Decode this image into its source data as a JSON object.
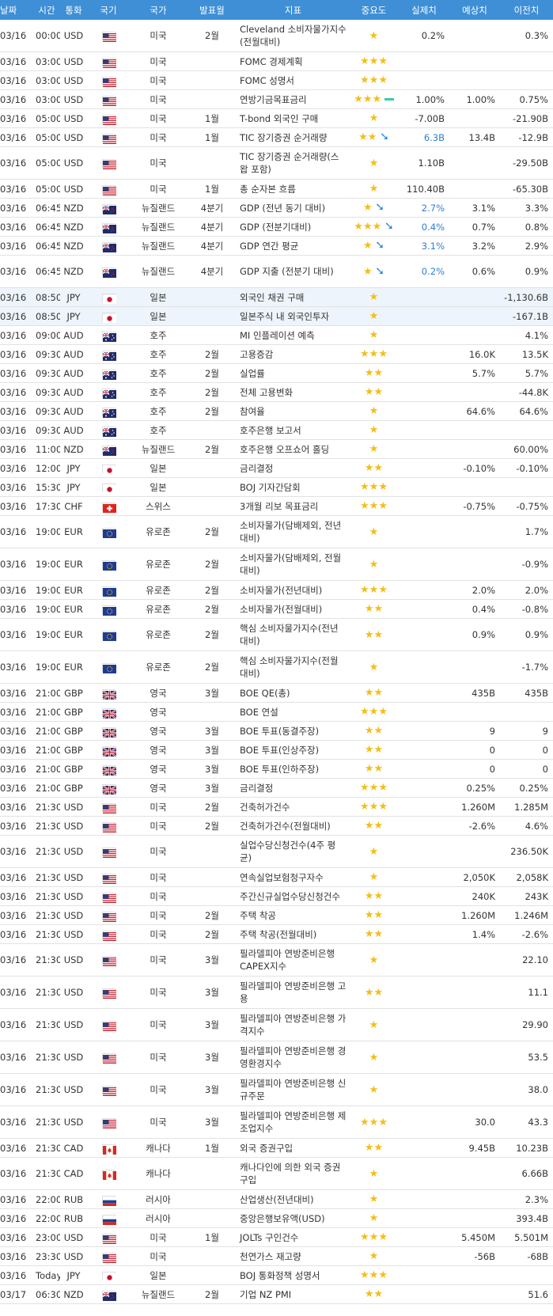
{
  "header": [
    "날짜",
    "시간",
    "통화",
    "국기",
    "국가",
    "발표월",
    "지표",
    "중요도",
    "실제치",
    "예상치",
    "이전치"
  ],
  "rows": [
    {
      "date": "03/16",
      "time": "00:00",
      "cur": "USD",
      "flag": "us",
      "country": "미국",
      "month": "2월",
      "ind": "Cleveland 소비자물가지수(전월대비)",
      "stars": 1,
      "trend": "",
      "actual": "0.2%",
      "forecast": "",
      "prev": "0.3%"
    },
    {
      "date": "03/16",
      "time": "03:00",
      "cur": "USD",
      "flag": "us",
      "country": "미국",
      "month": "",
      "ind": "FOMC 경제계획",
      "stars": 3,
      "trend": "",
      "actual": "",
      "forecast": "",
      "prev": ""
    },
    {
      "date": "03/16",
      "time": "03:00",
      "cur": "USD",
      "flag": "us",
      "country": "미국",
      "month": "",
      "ind": "FOMC 성명서",
      "stars": 3,
      "trend": "",
      "actual": "",
      "forecast": "",
      "prev": ""
    },
    {
      "date": "03/16",
      "time": "03:00",
      "cur": "USD",
      "flag": "us",
      "country": "미국",
      "month": "",
      "ind": "연방기금목표금리",
      "stars": 3,
      "trend": "flat",
      "actual": "1.00%",
      "forecast": "1.00%",
      "prev": "0.75%"
    },
    {
      "date": "03/16",
      "time": "05:00",
      "cur": "USD",
      "flag": "us",
      "country": "미국",
      "month": "1월",
      "ind": "T-bond 외국인 구매",
      "stars": 1,
      "trend": "",
      "actual": "-7.00B",
      "forecast": "",
      "prev": "-21.90B"
    },
    {
      "date": "03/16",
      "time": "05:00",
      "cur": "USD",
      "flag": "us",
      "country": "미국",
      "month": "1월",
      "ind": "TIC 장기증권 순거래량",
      "stars": 2,
      "trend": "down",
      "actual": "6.3B",
      "forecast": "13.4B",
      "prev": "-12.9B"
    },
    {
      "date": "03/16",
      "time": "05:00",
      "cur": "USD",
      "flag": "us",
      "country": "미국",
      "month": "",
      "ind": "TIC 장기증권 순거래량(스왑 포함)",
      "stars": 1,
      "trend": "",
      "actual": "1.10B",
      "forecast": "",
      "prev": "-29.50B"
    },
    {
      "date": "03/16",
      "time": "05:00",
      "cur": "USD",
      "flag": "us",
      "country": "미국",
      "month": "1월",
      "ind": "총 순자본 흐름",
      "stars": 1,
      "trend": "",
      "actual": "110.40B",
      "forecast": "",
      "prev": "-65.30B"
    },
    {
      "date": "03/16",
      "time": "06:45",
      "cur": "NZD",
      "flag": "nz",
      "country": "뉴질랜드",
      "month": "4분기",
      "ind": "GDP (전년 동기 대비)",
      "stars": 1,
      "trend": "down",
      "actual": "2.7%",
      "forecast": "3.1%",
      "prev": "3.3%"
    },
    {
      "date": "03/16",
      "time": "06:45",
      "cur": "NZD",
      "flag": "nz",
      "country": "뉴질랜드",
      "month": "4분기",
      "ind": "GDP (전분기대비)",
      "stars": 3,
      "trend": "down",
      "actual": "0.4%",
      "forecast": "0.7%",
      "prev": "0.8%"
    },
    {
      "date": "03/16",
      "time": "06:45",
      "cur": "NZD",
      "flag": "nz",
      "country": "뉴질랜드",
      "month": "4분기",
      "ind": "GDP 연간 평균",
      "stars": 1,
      "trend": "down",
      "actual": "3.1%",
      "forecast": "3.2%",
      "prev": "2.9%"
    },
    {
      "date": "03/16",
      "time": "06:45",
      "cur": "NZD",
      "flag": "nz",
      "country": "뉴질랜드",
      "month": "4분기",
      "ind": "GDP 지출 (전분기 대비)",
      "stars": 1,
      "trend": "down",
      "actual": "0.2%",
      "forecast": "0.6%",
      "prev": "0.9%"
    },
    {
      "date": "03/16",
      "time": "08:50",
      "cur": "JPY",
      "flag": "jp",
      "country": "일본",
      "month": "",
      "ind": "외국인 채권 구매",
      "stars": 1,
      "trend": "",
      "actual": "",
      "forecast": "",
      "prev": "-1,130.6B",
      "hl": true
    },
    {
      "date": "03/16",
      "time": "08:50",
      "cur": "JPY",
      "flag": "jp",
      "country": "일본",
      "month": "",
      "ind": "일본주식 내 외국인투자",
      "stars": 1,
      "trend": "",
      "actual": "",
      "forecast": "",
      "prev": "-167.1B",
      "hl": true
    },
    {
      "date": "03/16",
      "time": "09:00",
      "cur": "AUD",
      "flag": "au",
      "country": "호주",
      "month": "",
      "ind": "MI 인플레이션 예측",
      "stars": 1,
      "trend": "",
      "actual": "",
      "forecast": "",
      "prev": "4.1%"
    },
    {
      "date": "03/16",
      "time": "09:30",
      "cur": "AUD",
      "flag": "au",
      "country": "호주",
      "month": "2월",
      "ind": "고용증감",
      "stars": 3,
      "trend": "",
      "actual": "",
      "forecast": "16.0K",
      "prev": "13.5K"
    },
    {
      "date": "03/16",
      "time": "09:30",
      "cur": "AUD",
      "flag": "au",
      "country": "호주",
      "month": "2월",
      "ind": "실업률",
      "stars": 2,
      "trend": "",
      "actual": "",
      "forecast": "5.7%",
      "prev": "5.7%"
    },
    {
      "date": "03/16",
      "time": "09:30",
      "cur": "AUD",
      "flag": "au",
      "country": "호주",
      "month": "2월",
      "ind": "전체 고용변화",
      "stars": 2,
      "trend": "",
      "actual": "",
      "forecast": "",
      "prev": "-44.8K"
    },
    {
      "date": "03/16",
      "time": "09:30",
      "cur": "AUD",
      "flag": "au",
      "country": "호주",
      "month": "2월",
      "ind": "참여율",
      "stars": 1,
      "trend": "",
      "actual": "",
      "forecast": "64.6%",
      "prev": "64.6%"
    },
    {
      "date": "03/16",
      "time": "09:30",
      "cur": "AUD",
      "flag": "au",
      "country": "호주",
      "month": "",
      "ind": "호주은행 보고서",
      "stars": 1,
      "trend": "",
      "actual": "",
      "forecast": "",
      "prev": ""
    },
    {
      "date": "03/16",
      "time": "11:00",
      "cur": "NZD",
      "flag": "nz",
      "country": "뉴질랜드",
      "month": "2월",
      "ind": "호주은행 오프쇼어 홀딩",
      "stars": 1,
      "trend": "",
      "actual": "",
      "forecast": "",
      "prev": "60.00%"
    },
    {
      "date": "03/16",
      "time": "12:00",
      "cur": "JPY",
      "flag": "jp",
      "country": "일본",
      "month": "",
      "ind": "금리결정",
      "stars": 2,
      "trend": "",
      "actual": "",
      "forecast": "-0.10%",
      "prev": "-0.10%"
    },
    {
      "date": "03/16",
      "time": "15:30",
      "cur": "JPY",
      "flag": "jp",
      "country": "일본",
      "month": "",
      "ind": "BOJ 기자간담회",
      "stars": 3,
      "trend": "",
      "actual": "",
      "forecast": "",
      "prev": ""
    },
    {
      "date": "03/16",
      "time": "17:30",
      "cur": "CHF",
      "flag": "ch",
      "country": "스위스",
      "month": "",
      "ind": "3개월 리보 목표금리",
      "stars": 3,
      "trend": "",
      "actual": "",
      "forecast": "-0.75%",
      "prev": "-0.75%"
    },
    {
      "date": "03/16",
      "time": "19:00",
      "cur": "EUR",
      "flag": "eu",
      "country": "유로존",
      "month": "2월",
      "ind": "소비자물가(담배제외, 전년대비)",
      "stars": 1,
      "trend": "",
      "actual": "",
      "forecast": "",
      "prev": "1.7%"
    },
    {
      "date": "03/16",
      "time": "19:00",
      "cur": "EUR",
      "flag": "eu",
      "country": "유로존",
      "month": "2월",
      "ind": "소비자물가(담배제외, 전월대비)",
      "stars": 1,
      "trend": "",
      "actual": "",
      "forecast": "",
      "prev": "-0.9%"
    },
    {
      "date": "03/16",
      "time": "19:00",
      "cur": "EUR",
      "flag": "eu",
      "country": "유로존",
      "month": "2월",
      "ind": "소비자물가(전년대비)",
      "stars": 3,
      "trend": "",
      "actual": "",
      "forecast": "2.0%",
      "prev": "2.0%"
    },
    {
      "date": "03/16",
      "time": "19:00",
      "cur": "EUR",
      "flag": "eu",
      "country": "유로존",
      "month": "2월",
      "ind": "소비자물가(전월대비)",
      "stars": 2,
      "trend": "",
      "actual": "",
      "forecast": "0.4%",
      "prev": "-0.8%"
    },
    {
      "date": "03/16",
      "time": "19:00",
      "cur": "EUR",
      "flag": "eu",
      "country": "유로존",
      "month": "2월",
      "ind": "핵심 소비자물가지수(전년대비)",
      "stars": 2,
      "trend": "",
      "actual": "",
      "forecast": "0.9%",
      "prev": "0.9%"
    },
    {
      "date": "03/16",
      "time": "19:00",
      "cur": "EUR",
      "flag": "eu",
      "country": "유로존",
      "month": "2월",
      "ind": "핵심 소비자물가지수(전월대비)",
      "stars": 1,
      "trend": "",
      "actual": "",
      "forecast": "",
      "prev": "-1.7%"
    },
    {
      "date": "03/16",
      "time": "21:00",
      "cur": "GBP",
      "flag": "gb",
      "country": "영국",
      "month": "3월",
      "ind": "BOE QE(총)",
      "stars": 2,
      "trend": "",
      "actual": "",
      "forecast": "435B",
      "prev": "435B"
    },
    {
      "date": "03/16",
      "time": "21:00",
      "cur": "GBP",
      "flag": "gb",
      "country": "영국",
      "month": "",
      "ind": "BOE 연설",
      "stars": 3,
      "trend": "",
      "actual": "",
      "forecast": "",
      "prev": ""
    },
    {
      "date": "03/16",
      "time": "21:00",
      "cur": "GBP",
      "flag": "gb",
      "country": "영국",
      "month": "3월",
      "ind": "BOE 투표(동결주장)",
      "stars": 2,
      "trend": "",
      "actual": "",
      "forecast": "9",
      "prev": "9"
    },
    {
      "date": "03/16",
      "time": "21:00",
      "cur": "GBP",
      "flag": "gb",
      "country": "영국",
      "month": "3월",
      "ind": "BOE 투표(인상주장)",
      "stars": 2,
      "trend": "",
      "actual": "",
      "forecast": "0",
      "prev": "0"
    },
    {
      "date": "03/16",
      "time": "21:00",
      "cur": "GBP",
      "flag": "gb",
      "country": "영국",
      "month": "3월",
      "ind": "BOE 투표(인하주장)",
      "stars": 2,
      "trend": "",
      "actual": "",
      "forecast": "0",
      "prev": "0"
    },
    {
      "date": "03/16",
      "time": "21:00",
      "cur": "GBP",
      "flag": "gb",
      "country": "영국",
      "month": "3월",
      "ind": "금리결정",
      "stars": 3,
      "trend": "",
      "actual": "",
      "forecast": "0.25%",
      "prev": "0.25%"
    },
    {
      "date": "03/16",
      "time": "21:30",
      "cur": "USD",
      "flag": "us",
      "country": "미국",
      "month": "2월",
      "ind": "건축허가건수",
      "stars": 3,
      "trend": "",
      "actual": "",
      "forecast": "1.260M",
      "prev": "1.285M"
    },
    {
      "date": "03/16",
      "time": "21:30",
      "cur": "USD",
      "flag": "us",
      "country": "미국",
      "month": "2월",
      "ind": "건축허가건수(전월대비)",
      "stars": 2,
      "trend": "",
      "actual": "",
      "forecast": "-2.6%",
      "prev": "4.6%"
    },
    {
      "date": "03/16",
      "time": "21:30",
      "cur": "USD",
      "flag": "us",
      "country": "미국",
      "month": "",
      "ind": "실업수당신청건수(4주 평균)",
      "stars": 1,
      "trend": "",
      "actual": "",
      "forecast": "",
      "prev": "236.50K"
    },
    {
      "date": "03/16",
      "time": "21:30",
      "cur": "USD",
      "flag": "us",
      "country": "미국",
      "month": "",
      "ind": "연속실업보험청구자수",
      "stars": 1,
      "trend": "",
      "actual": "",
      "forecast": "2,050K",
      "prev": "2,058K"
    },
    {
      "date": "03/16",
      "time": "21:30",
      "cur": "USD",
      "flag": "us",
      "country": "미국",
      "month": "",
      "ind": "주간신규실업수당신청건수",
      "stars": 2,
      "trend": "",
      "actual": "",
      "forecast": "240K",
      "prev": "243K"
    },
    {
      "date": "03/16",
      "time": "21:30",
      "cur": "USD",
      "flag": "us",
      "country": "미국",
      "month": "2월",
      "ind": "주택 착공",
      "stars": 2,
      "trend": "",
      "actual": "",
      "forecast": "1.260M",
      "prev": "1.246M"
    },
    {
      "date": "03/16",
      "time": "21:30",
      "cur": "USD",
      "flag": "us",
      "country": "미국",
      "month": "2월",
      "ind": "주택 착공(전월대비)",
      "stars": 2,
      "trend": "",
      "actual": "",
      "forecast": "1.4%",
      "prev": "-2.6%"
    },
    {
      "date": "03/16",
      "time": "21:30",
      "cur": "USD",
      "flag": "us",
      "country": "미국",
      "month": "3월",
      "ind": "필라델피아 연방준비은행 CAPEX지수",
      "stars": 1,
      "trend": "",
      "actual": "",
      "forecast": "",
      "prev": "22.10"
    },
    {
      "date": "03/16",
      "time": "21:30",
      "cur": "USD",
      "flag": "us",
      "country": "미국",
      "month": "3월",
      "ind": "필라델피아 연방준비은행 고용",
      "stars": 2,
      "trend": "",
      "actual": "",
      "forecast": "",
      "prev": "11.1"
    },
    {
      "date": "03/16",
      "time": "21:30",
      "cur": "USD",
      "flag": "us",
      "country": "미국",
      "month": "3월",
      "ind": "필라델피아 연방준비은행 가격지수",
      "stars": 1,
      "trend": "",
      "actual": "",
      "forecast": "",
      "prev": "29.90"
    },
    {
      "date": "03/16",
      "time": "21:30",
      "cur": "USD",
      "flag": "us",
      "country": "미국",
      "month": "3월",
      "ind": "필라델피아 연방준비은행 경영환경지수",
      "stars": 1,
      "trend": "",
      "actual": "",
      "forecast": "",
      "prev": "53.5"
    },
    {
      "date": "03/16",
      "time": "21:30",
      "cur": "USD",
      "flag": "us",
      "country": "미국",
      "month": "3월",
      "ind": "필라델피아 연방준비은행 신규주문",
      "stars": 1,
      "trend": "",
      "actual": "",
      "forecast": "",
      "prev": "38.0"
    },
    {
      "date": "03/16",
      "time": "21:30",
      "cur": "USD",
      "flag": "us",
      "country": "미국",
      "month": "3월",
      "ind": "필라델피아 연방준비은행 제조업지수",
      "stars": 3,
      "trend": "",
      "actual": "",
      "forecast": "30.0",
      "prev": "43.3"
    },
    {
      "date": "03/16",
      "time": "21:30",
      "cur": "CAD",
      "flag": "ca",
      "country": "캐나다",
      "month": "1월",
      "ind": "외국 증권구입",
      "stars": 2,
      "trend": "",
      "actual": "",
      "forecast": "9.45B",
      "prev": "10.23B"
    },
    {
      "date": "03/16",
      "time": "21:30",
      "cur": "CAD",
      "flag": "ca",
      "country": "캐나다",
      "month": "",
      "ind": "캐나다인에 의한 외국 증권구입",
      "stars": 1,
      "trend": "",
      "actual": "",
      "forecast": "",
      "prev": "6.66B"
    },
    {
      "date": "03/16",
      "time": "22:00",
      "cur": "RUB",
      "flag": "ru",
      "country": "러시아",
      "month": "",
      "ind": "산업생산(전년대비)",
      "stars": 1,
      "trend": "",
      "actual": "",
      "forecast": "",
      "prev": "2.3%"
    },
    {
      "date": "03/16",
      "time": "22:00",
      "cur": "RUB",
      "flag": "ru",
      "country": "러시아",
      "month": "",
      "ind": "중앙은행보유액(USD)",
      "stars": 1,
      "trend": "",
      "actual": "",
      "forecast": "",
      "prev": "393.4B"
    },
    {
      "date": "03/16",
      "time": "23:00",
      "cur": "USD",
      "flag": "us",
      "country": "미국",
      "month": "1월",
      "ind": "JOLTs 구인건수",
      "stars": 3,
      "trend": "",
      "actual": "",
      "forecast": "5.450M",
      "prev": "5.501M"
    },
    {
      "date": "03/16",
      "time": "23:30",
      "cur": "USD",
      "flag": "us",
      "country": "미국",
      "month": "",
      "ind": "천연가스 재고량",
      "stars": 1,
      "trend": "",
      "actual": "",
      "forecast": "-56B",
      "prev": "-68B"
    },
    {
      "date": "03/16",
      "time": "Today",
      "cur": "JPY",
      "flag": "jp",
      "country": "일본",
      "month": "",
      "ind": "BOJ 통화정책 성명서",
      "stars": 3,
      "trend": "",
      "actual": "",
      "forecast": "",
      "prev": ""
    },
    {
      "date": "03/17",
      "time": "06:30",
      "cur": "NZD",
      "flag": "nz",
      "country": "뉴질랜드",
      "month": "2월",
      "ind": "기업 NZ PMI",
      "stars": 2,
      "trend": "",
      "actual": "",
      "forecast": "",
      "prev": "51.6"
    }
  ]
}
